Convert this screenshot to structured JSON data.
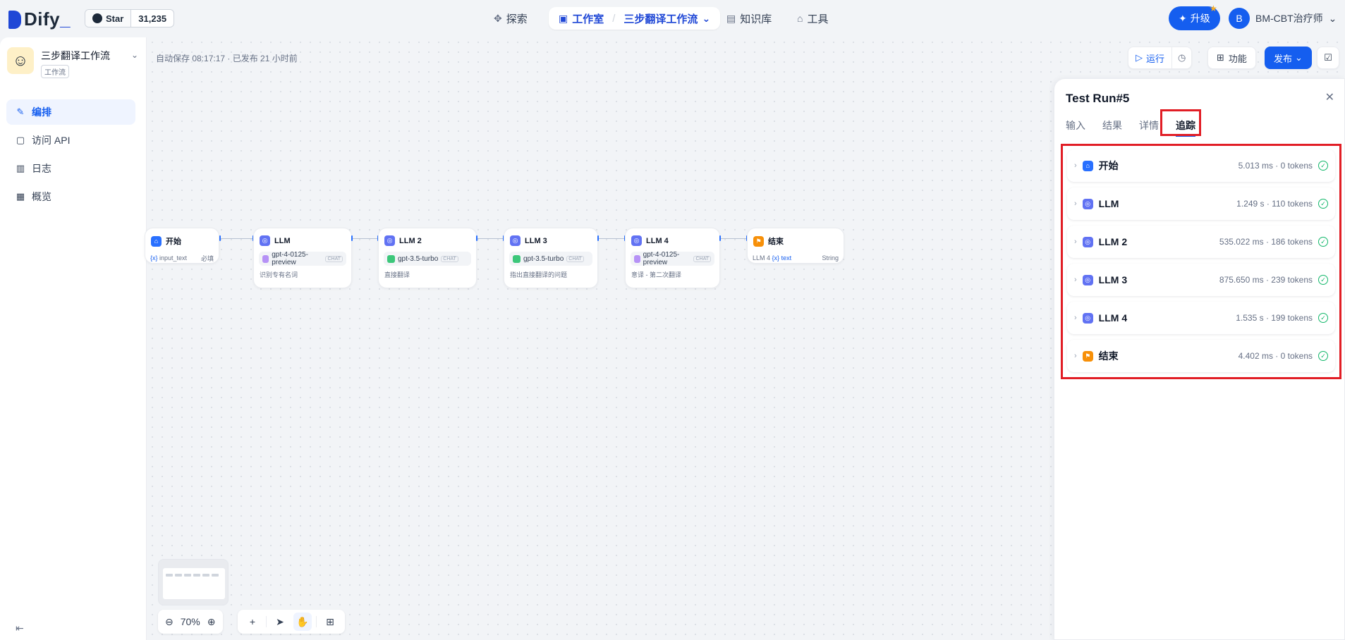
{
  "header": {
    "brand": "Dify",
    "github_label": "Star",
    "github_count": "31,235",
    "nav": {
      "explore": "探索",
      "studio": "工作室",
      "current_app": "三步翻译工作流",
      "knowledge": "知识库",
      "tools": "工具"
    },
    "upgrade_label": "升级",
    "user_initial": "B",
    "user_name": "BM-CBT治疗师"
  },
  "sidebar": {
    "app_name": "三步翻译工作流",
    "app_type": "工作流",
    "items": [
      {
        "label": "编排",
        "icon": "orchestrate-icon",
        "active": true
      },
      {
        "label": "访问 API",
        "icon": "terminal-icon",
        "active": false
      },
      {
        "label": "日志",
        "icon": "log-icon",
        "active": false
      },
      {
        "label": "概览",
        "icon": "chart-icon",
        "active": false
      }
    ]
  },
  "toolbar": {
    "autosave": "自动保存 08:17:17 · 已发布 21 小时前",
    "run_label": "运行",
    "features_label": "功能",
    "publish_label": "发布"
  },
  "workflow": {
    "nodes": [
      {
        "title": "开始",
        "var": "input_text",
        "required": "必填"
      },
      {
        "title": "LLM",
        "model": "gpt-4-0125-preview",
        "mode": "CHAT",
        "desc": "识别专有名词"
      },
      {
        "title": "LLM 2",
        "model": "gpt-3.5-turbo",
        "mode": "CHAT",
        "desc": "直接翻译"
      },
      {
        "title": "LLM 3",
        "model": "gpt-3.5-turbo",
        "mode": "CHAT",
        "desc": "指出直接翻译的问题"
      },
      {
        "title": "LLM 4",
        "model": "gpt-4-0125-preview",
        "mode": "CHAT",
        "desc": "意译 - 第二次翻译"
      },
      {
        "title": "结束",
        "source": "LLM 4",
        "var": "text",
        "type": "String"
      }
    ]
  },
  "zoom": "70%",
  "panel": {
    "title": "Test Run#5",
    "tabs": [
      "输入",
      "结果",
      "详情",
      "追踪"
    ],
    "active_tab": "追踪",
    "trace": [
      {
        "name": "开始",
        "meta": "5.013 ms · 0 tokens"
      },
      {
        "name": "LLM",
        "meta": "1.249 s · 110 tokens"
      },
      {
        "name": "LLM 2",
        "meta": "535.022 ms · 186 tokens"
      },
      {
        "name": "LLM 3",
        "meta": "875.650 ms · 239 tokens"
      },
      {
        "name": "LLM 4",
        "meta": "1.535 s · 199 tokens"
      },
      {
        "name": "结束",
        "meta": "4.402 ms · 0 tokens"
      }
    ]
  },
  "colors": {
    "accent": "#155eef",
    "highlight": "#e11d25",
    "success": "#12b76a"
  }
}
